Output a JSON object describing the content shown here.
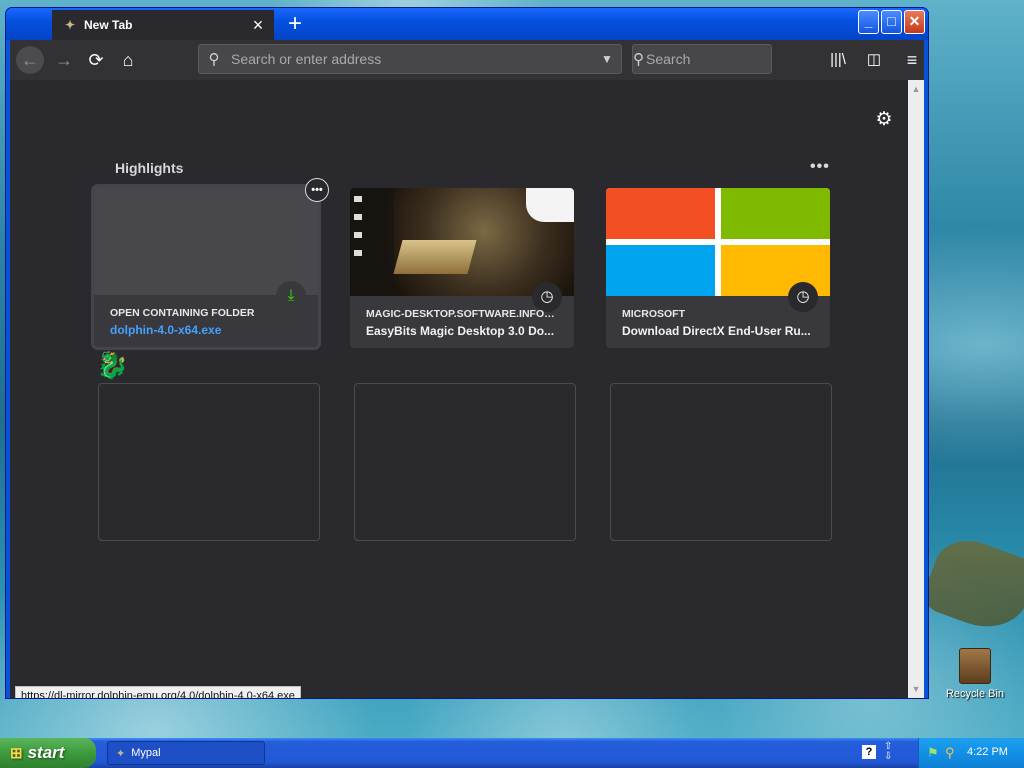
{
  "window": {
    "tab_title": "New Tab",
    "tab_close": "×",
    "new_tab": "+",
    "controls": {
      "minimize": "_",
      "maximize": "□",
      "close": "✕"
    }
  },
  "toolbar": {
    "url_placeholder": "Search or enter address",
    "search_placeholder": "Search"
  },
  "highlights": {
    "title": "Highlights",
    "menu": "•••",
    "cards": [
      {
        "source": "OPEN CONTAINING FOLDER",
        "title": "dolphin-4.0-x64.exe",
        "badge_icon": "download-icon"
      },
      {
        "source": "MAGIC-DESKTOP.SOFTWARE.INFOR...",
        "title": "EasyBits Magic Desktop 3.0 Do...",
        "badge_icon": "clock-icon"
      },
      {
        "source": "MICROSOFT",
        "title": "Download DirectX End-User Ru...",
        "badge_icon": "clock-icon"
      }
    ],
    "card_menu": "•••"
  },
  "status_url": "https://dl-mirror.dolphin-emu.org/4.0/dolphin-4.0-x64.exe",
  "desktop": {
    "recycle_bin": "Recycle Bin"
  },
  "taskbar": {
    "start": "start",
    "task": "Mypal",
    "clock": "4:22 PM",
    "help": "?"
  },
  "colors": {
    "xp_blue": "#0a53d8",
    "content_bg": "#2a2a2e",
    "card_bg": "#38383d",
    "link": "#45a1ff",
    "download_green": "#30e60b",
    "ms_red": "#f25022",
    "ms_green": "#7fba00",
    "ms_blue": "#00a4ef",
    "ms_yellow": "#ffb900"
  }
}
